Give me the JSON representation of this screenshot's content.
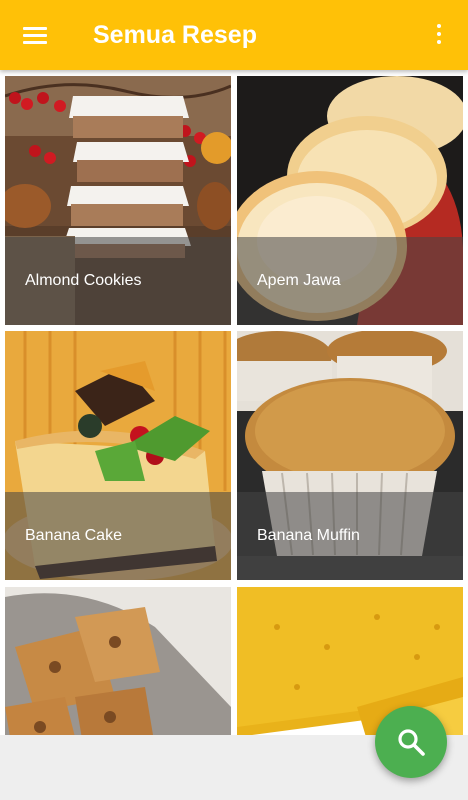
{
  "app": {
    "title": "Semua Resep"
  },
  "icons": {
    "menu": "hamburger-menu-icon",
    "more": "more-vertical-icon",
    "search": "search-icon"
  },
  "colors": {
    "appbar": "#ffc107",
    "fab": "#4caf50",
    "label_overlay": "rgba(70,70,70,0.55)"
  },
  "recipes": [
    {
      "name": "Almond Cookies"
    },
    {
      "name": "Apem Jawa"
    },
    {
      "name": "Banana Cake"
    },
    {
      "name": "Banana Muffin"
    },
    {
      "name": ""
    },
    {
      "name": ""
    }
  ]
}
